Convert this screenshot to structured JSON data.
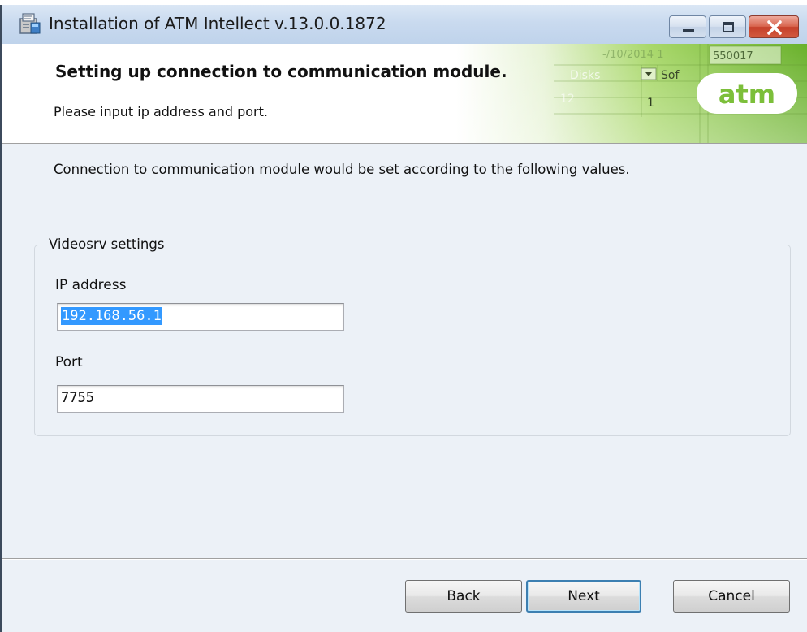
{
  "window": {
    "title": "Installation of ATM Intellect v.13.0.0.1872",
    "icon": "installer-icon",
    "caption_buttons": [
      "minimize-icon",
      "maximize-icon",
      "close-icon"
    ]
  },
  "banner": {
    "title": "Setting up connection to communication module.",
    "subtitle": "Please input ip address and port.",
    "logo_text": "atm",
    "graphic_texts": {
      "date": "-/10/2014 1",
      "id": "550017",
      "disks": "Disks",
      "soft": "Sof",
      "col_a": "12",
      "col_b": "1"
    }
  },
  "main": {
    "intro": "Connection to communication module would be set according to the following values.",
    "group": {
      "legend": "Videosrv settings",
      "ip_label": "IP address",
      "ip_value": "192.168.56.1",
      "port_label": "Port",
      "port_value": "7755"
    }
  },
  "buttons": {
    "back": "Back",
    "next": "Next",
    "cancel": "Cancel"
  },
  "colors": {
    "accent_green": "#7cbf3a",
    "selection": "#3399ff",
    "close_red": "#c5402a"
  }
}
